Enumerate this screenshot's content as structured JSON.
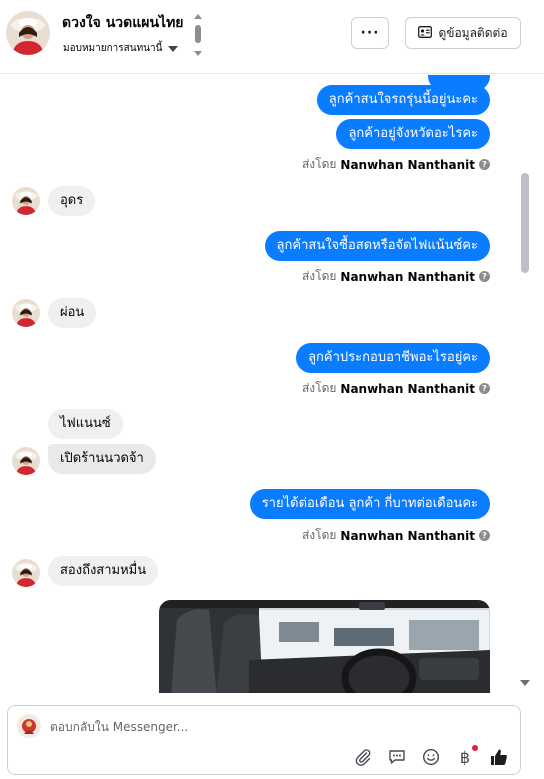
{
  "header": {
    "name": "ดวงใจ นวดแผนไทย",
    "assign_label": "มอบหมายการสนทนานี้",
    "more_label": "···",
    "contact_label": "ดูข้อมูลติดต่อ"
  },
  "messages": {
    "out_1": "ลูกค้าสนใจรถรุ่นนี้อยู่นะคะ",
    "out_2": "ลูกค้าอยู่จังหวัดอะไรคะ",
    "sent_1_prefix": "ส่งโดย",
    "sent_1_name": "Nanwhan Nanthanit",
    "in_1": "อุดร",
    "out_3": "ลูกค้าสนใจซื้อสดหรือจัดไฟแน้นซ์คะ",
    "sent_2_prefix": "ส่งโดย",
    "sent_2_name": "Nanwhan Nanthanit",
    "in_2": "ผ่อน",
    "out_4": "ลูกค้าประกอบอาชีพอะไรอยู่คะ",
    "sent_3_prefix": "ส่งโดย",
    "sent_3_name": "Nanwhan Nanthanit",
    "in_3": "ไฟแนนซ์",
    "in_4": "เปิดร้านนวดจ้า",
    "out_5": "รายได้ต่อเดือน  ลูกค้า กี่บาทต่อเดือนคะ",
    "sent_4_prefix": "ส่งโดย",
    "sent_4_name": "Nanwhan Nanthanit",
    "in_5": "สองถึงสามหมื่น"
  },
  "composer": {
    "placeholder": "ตอบกลับใน Messenger...",
    "currency_symbol": "฿"
  },
  "colors": {
    "outgoing_bubble": "#0a7cff",
    "incoming_bubble": "#f0f0f0",
    "like_icon": "#1c1e21"
  }
}
